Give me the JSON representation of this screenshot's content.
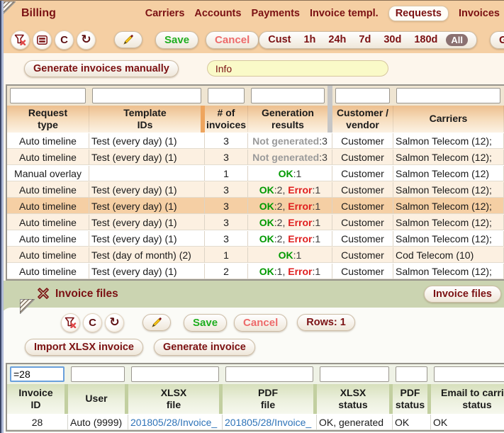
{
  "colors": {
    "accent_maroon": "#7b1113",
    "header_peach": "#f5cfa3",
    "panel2_green": "#cbd4b1",
    "save_green": "#1fae1f",
    "cancel_red": "#ed6a6a",
    "link_blue": "#2e73b8",
    "ok_green": "#009900",
    "error_red": "#e02020",
    "not_generated_gray": "#9a9a9a",
    "selected_row": "#f5cfa4",
    "alt_row": "#fcf0e1"
  },
  "header": {
    "title": "Billing",
    "nav": [
      {
        "label": "Carriers"
      },
      {
        "label": "Accounts"
      },
      {
        "label": "Payments"
      },
      {
        "label": "Invoice templ."
      },
      {
        "label": "Requests",
        "active": true
      },
      {
        "label": "Invoices"
      }
    ]
  },
  "toolbar": {
    "icons": [
      "filter-clear-funnel-x",
      "rows-layout",
      "letter-c",
      "refresh-arrow",
      "edit-pencil"
    ],
    "c_glyph": "C",
    "refresh_glyph": "↻",
    "save_label": "Save",
    "cancel_label": "Cancel",
    "range": [
      "Cust",
      "1h",
      "24h",
      "7d",
      "30d",
      "180d"
    ],
    "range_selected": "All",
    "go_label": "GO"
  },
  "actions": {
    "generate_label": "Generate invoices manually",
    "info_value": "Info"
  },
  "requests_table": {
    "columns": [
      "Request\ntype",
      "Template\nIDs",
      "# of\ninvoices",
      "Generation\nresults",
      "Customer /\nvendor",
      "Carriers"
    ],
    "rows": [
      {
        "type": "Auto timeline",
        "templates": "Test (every day) (1)",
        "count": "3",
        "results": {
          "ng": "Not generated",
          "ngc": ":3"
        },
        "customer": "Customer",
        "carriers": "Salmon Telecom (12);"
      },
      {
        "type": "Auto timeline",
        "templates": "Test (every day) (1)",
        "count": "3",
        "results": {
          "ng": "Not generated",
          "ngc": ":3"
        },
        "customer": "Customer",
        "carriers": "Salmon Telecom (12);"
      },
      {
        "type": "Manual overlay",
        "templates": "",
        "count": "1",
        "results": {
          "ok": "OK",
          "okc": ":1"
        },
        "customer": "Customer",
        "carriers": "Salmon Telecom (12)"
      },
      {
        "type": "Auto timeline",
        "templates": "Test (every day) (1)",
        "count": "3",
        "results": {
          "ok": "OK",
          "okc": ":2, ",
          "err": "Error",
          "errc": ":1"
        },
        "customer": "Customer",
        "carriers": "Salmon Telecom (12);"
      },
      {
        "type": "Auto timeline",
        "templates": "Test (every day) (1)",
        "count": "3",
        "results": {
          "ok": "OK",
          "okc": ":2, ",
          "err": "Error",
          "errc": ":1"
        },
        "customer": "Customer",
        "carriers": "Salmon Telecom (12);",
        "selected": true
      },
      {
        "type": "Auto timeline",
        "templates": "Test (every day) (1)",
        "count": "3",
        "results": {
          "ok": "OK",
          "okc": ":2, ",
          "err": "Error",
          "errc": ":1"
        },
        "customer": "Customer",
        "carriers": "Salmon Telecom (12);"
      },
      {
        "type": "Auto timeline",
        "templates": "Test (every day) (1)",
        "count": "3",
        "results": {
          "ok": "OK",
          "okc": ":2, ",
          "err": "Error",
          "errc": ":1"
        },
        "customer": "Customer",
        "carriers": "Salmon Telecom (12);"
      },
      {
        "type": "Auto timeline",
        "templates": "Test (day of month) (2)",
        "count": "1",
        "results": {
          "ok": "OK",
          "okc": ":1"
        },
        "customer": "Customer",
        "carriers": "Cod Telecom (10)"
      },
      {
        "type": "Auto timeline",
        "templates": "Test (every day) (1)",
        "count": "2",
        "results": {
          "ok": "OK",
          "okc": ":1, ",
          "err": "Error",
          "errc": ":1"
        },
        "customer": "Customer",
        "carriers": "Salmon Telecom (12);"
      }
    ]
  },
  "invoice_files": {
    "title": "Invoice files",
    "corner_button": "Invoice files",
    "toolbar": {
      "c_glyph": "C",
      "refresh_glyph": "↻",
      "save_label": "Save",
      "cancel_label": "Cancel",
      "rows_label": "Rows: 1"
    },
    "buttons": {
      "import_label": "Import XLSX invoice",
      "generate_label": "Generate invoice"
    },
    "filter_value": "=28",
    "columns": [
      "Invoice\nID",
      "User",
      "XLSX\nfile",
      "PDF\nfile",
      "XLSX\nstatus",
      "PDF\nstatus",
      "Email to carrier\nstatus"
    ],
    "row": {
      "id": "28",
      "user": "Auto (9999)",
      "xlsx_file": "201805/28/Invoice_",
      "pdf_file": "201805/28/Invoice_",
      "xlsx_status": "OK, generated",
      "pdf_status": "OK",
      "email_status": "OK"
    }
  }
}
